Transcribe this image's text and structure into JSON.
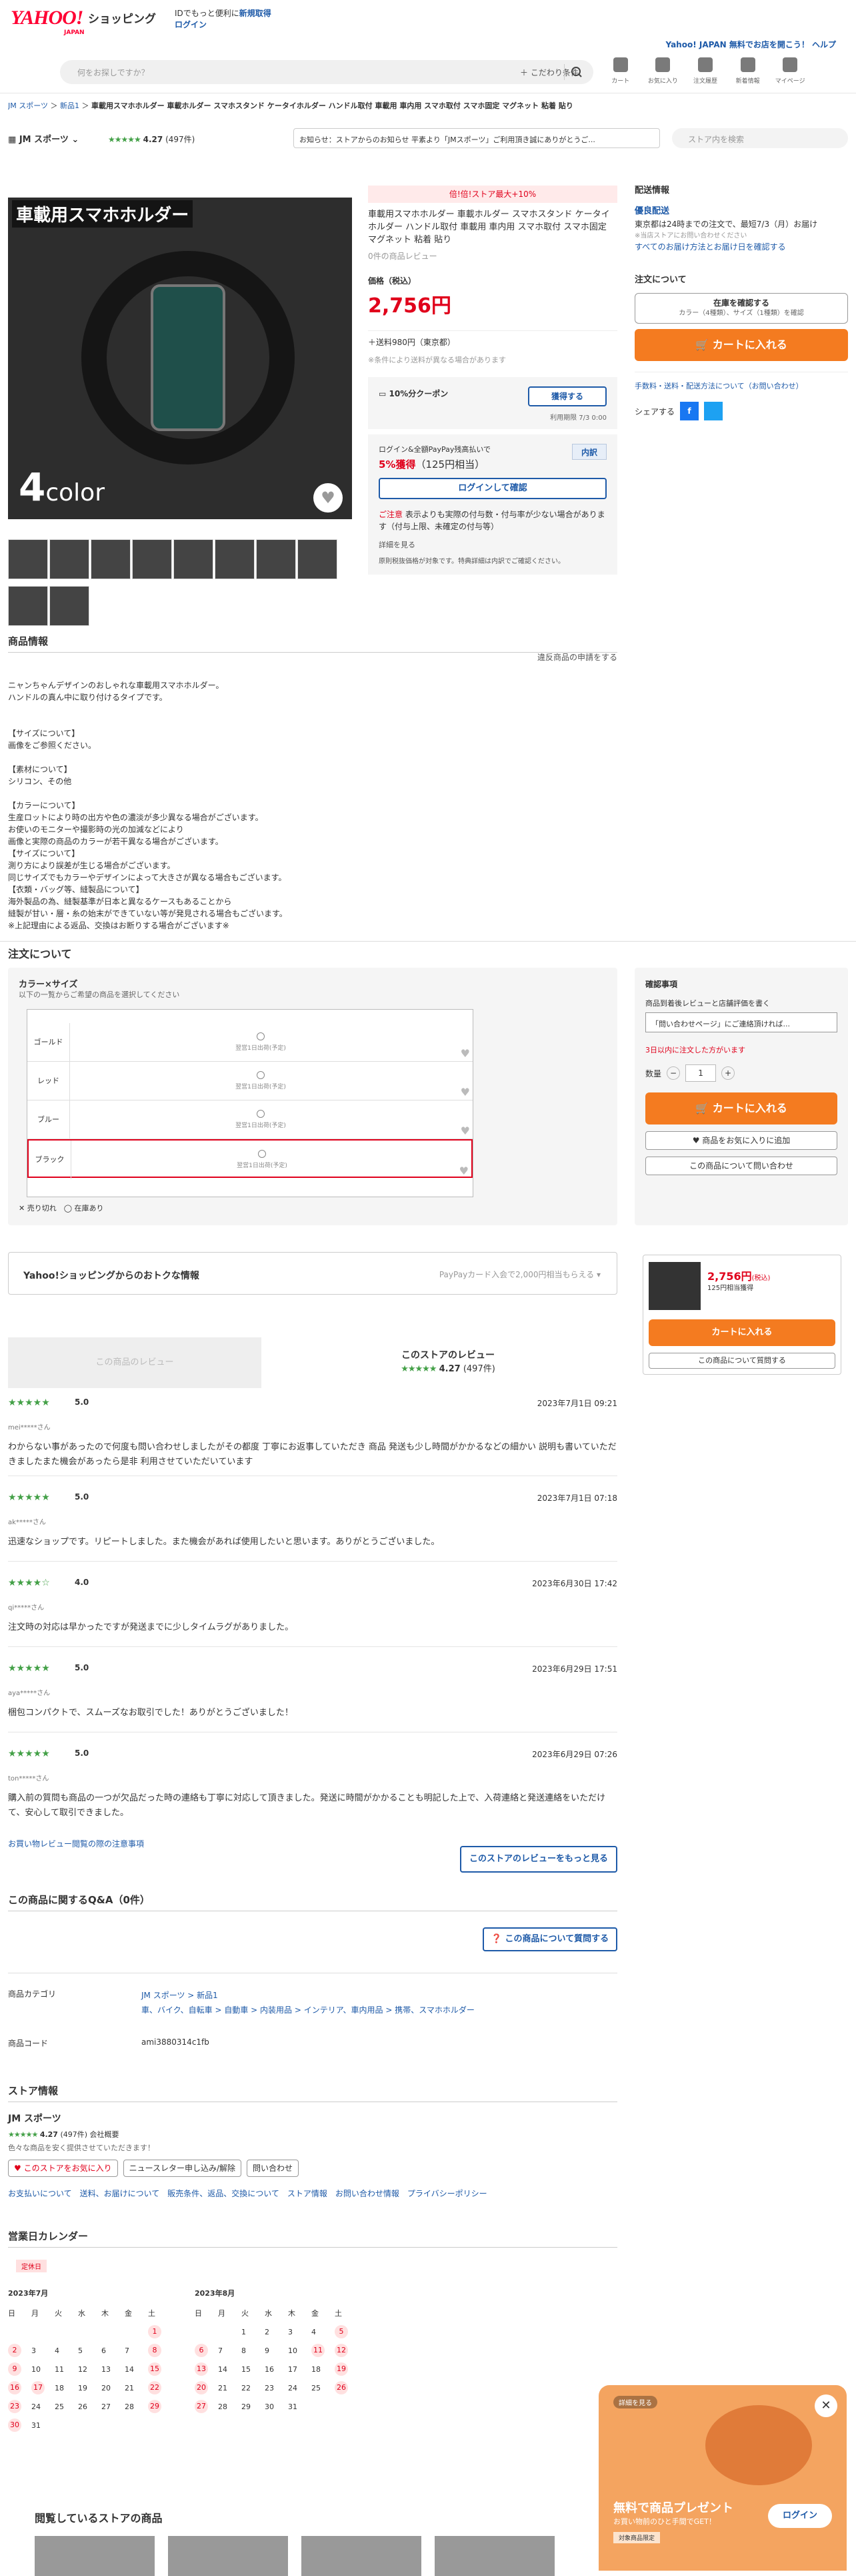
{
  "header": {
    "logo": "YAHOO!",
    "logo_sub": "JAPAN",
    "shopping": "ショッピング",
    "promo_line1": "IDでもっと便利に",
    "promo_link": "新規取得",
    "promo_login": "ログイン",
    "right_link": "Yahoo! JAPAN 無料でお店を開こう！ ヘルプ",
    "search_placeholder": "何をお探しですか？",
    "kodawari": "＋ こだわり条件",
    "nav": [
      "カート",
      "お気に入り",
      "注文履歴",
      "新着情報",
      "マイページ"
    ]
  },
  "breadcrumb": [
    "JM スポーツ",
    "新品1",
    "車載用スマホホルダー 車載ホルダー スマホスタンド ケータイホルダー ハンドル取付 車載用 車内用 スマホ取付 スマホ固定 マグネット 粘着 貼り"
  ],
  "store_bar": {
    "name": "JM スポーツ",
    "stars": "★★★★★",
    "rating": "4.27",
    "count": "(497件)",
    "notice": "お知らせ：ストアからのお知らせ 平素より「JMスポーツ」ご利用頂き誠にありがとうご...",
    "store_search_placeholder": "ストア内を検索"
  },
  "main_image": {
    "title": "車載用スマホホルダー",
    "color_count": "4",
    "color_word": "color"
  },
  "product": {
    "badge": "倍!倍!ストア最大+10%",
    "title": "車載用スマホホルダー 車載ホルダー スマホスタンド ケータイホルダー ハンドル取付 車載用 車内用 スマホ取付 スマホ固定 マグネット 粘着 貼り",
    "reviews": "0件の商品レビュー",
    "price_label": "価格（税込）",
    "price": "2,756円",
    "shipping": "＋送料980円（東京都）",
    "shipping_note": "※条件により送料が異なる場合があります",
    "coupon_name": "10%分クーポン",
    "coupon_btn": "獲得する",
    "coupon_limit": "利用期限 7/3 0:00",
    "pay_line": "ログイン&全額PayPay残高払いで",
    "points": "5%獲得",
    "points_sub": "（125円相当）",
    "points_detail": "内訳",
    "login_btn": "ログインして確認",
    "caution_label": "ご注意",
    "caution_text": "表示よりも実際の付与数・付与率が少ない場合があります（付与上限、未確定の付与等）",
    "detail_link": "詳細を見る",
    "note": "原則税抜価格が対象です。特典詳細は内訳でご確認ください。"
  },
  "side": {
    "delivery_h": "配送情報",
    "yusen": "優良配送",
    "deliv1": "東京都は24時までの注文で、最短7/3（月）お届け",
    "deliv_note": "※当店ストアにお問い合わせください",
    "deliv_link": "すべてのお届け方法とお届け日を確認する",
    "order_h": "注文について",
    "stock_btn": "在庫を確認する",
    "stock_sub": "カラー（4種類）、サイズ（1種類）を確認",
    "cart": "カートに入れる",
    "links": "手数料・送料・配送方法について（お問い合わせ）",
    "share": "シェアする"
  },
  "info": {
    "heading": "商品情報",
    "report": "違反商品の申請をする",
    "body": "ニャンちゃんデザインのおしゃれな車載用スマホホルダー。\nハンドルの真ん中に取り付けるタイプです。\n\n\n【サイズについて】\n画像をご参照ください。\n\n【素材について】\nシリコン、その他\n\n【カラーについて】\n生産ロットにより時の出方や色の濃淡が多少異なる場合がございます。\nお使いのモニターや撮影時の光の加減などにより\n画像と実際の商品のカラーが若干異なる場合がございます。\n【サイズについて】\n測り方により誤差が生じる場合がございます。\n同じサイズでもカラーやデザインによって大きさが異なる場合もございます。\n【衣類・バッグ等、縫製品について】\n海外製品の為、縫製基準が日本と異なるケースもあることから\n縫製が甘い・層・糸の始末ができていない等が発見される場合もございます。\n※上記理由による返品、交換はお断りする場合がございます※"
  },
  "order": {
    "heading": "注文について",
    "panel_title": "カラー×サイズ",
    "panel_sub": "以下の一覧からご希望の商品を選択してください",
    "rows": [
      {
        "name": "ゴールド",
        "status": "翌営1日出荷(予定)"
      },
      {
        "name": "レッド",
        "status": "翌営1日出荷(予定)"
      },
      {
        "name": "ブルー",
        "status": "翌営1日出荷(予定)"
      },
      {
        "name": "ブラック",
        "status": "翌営1日出荷(予定)"
      }
    ],
    "legend": "✕ 売り切れ　◯ 在庫あり",
    "conf_h": "確認事項",
    "conf_l": "商品到着後レビューと店舗評価を書く",
    "conf_sel": "「問い合わせページ」にご連絡頂ければ...",
    "conf_warn": "3日以内に注文した方がいます",
    "qty_label": "数量",
    "qty": "1",
    "cart": "カートに入れる",
    "fav": "♥ 商品をお気に入りに追加",
    "ask": "この商品について問い合わせ"
  },
  "deals": {
    "title": "Yahoo!ショッピングからのおトクな情報",
    "right": "PayPayカード入会で2,000円相当もらえる ▾"
  },
  "mini": {
    "price": "2,756円",
    "tax": "(税込)",
    "points": "125円相当獲得",
    "cart": "カートに入れる",
    "ask": "この商品について質問する"
  },
  "reviews": {
    "tab": "この商品のレビュー",
    "store_h": "このストアのレビュー",
    "stars": "★★★★★",
    "rating": "4.27",
    "count": "(497件)",
    "items": [
      {
        "stars": "★★★★★",
        "score": "5.0",
        "date": "2023年7月1日 09:21",
        "user": "mei*****さん",
        "text": "わからない事があったので何度も問い合わせしましたがその都度 丁寧にお返事していただき 商品 発送も少し時間がかかるなどの細かい 説明も書いていただきましたまた機会があったら是非 利用させていただいています"
      },
      {
        "stars": "★★★★★",
        "score": "5.0",
        "date": "2023年7月1日 07:18",
        "user": "ak*****さん",
        "text": "迅速なショップです。リピートしました。また機会があれば使用したいと思います。ありがとうございました。"
      },
      {
        "stars": "★★★★☆",
        "score": "4.0",
        "date": "2023年6月30日 17:42",
        "user": "qi*****さん",
        "text": "注文時の対応は早かったですが発送までに少しタイムラグがありました。"
      },
      {
        "stars": "★★★★★",
        "score": "5.0",
        "date": "2023年6月29日 17:51",
        "user": "aya*****さん",
        "text": "梱包コンパクトで、スムーズなお取引でした！ありがとうございました！"
      },
      {
        "stars": "★★★★★",
        "score": "5.0",
        "date": "2023年6月29日 07:26",
        "user": "ton*****さん",
        "text": "購入前の質問も商品の一つが欠品だった時の連絡も丁寧に対応して頂きました。発送に時間がかかることも明記した上で、入荷連絡と発送連絡をいただけて、安心して取引できました。"
      }
    ],
    "more_link": "お買い物レビュー閲覧の際の注意事項",
    "more_btn": "このストアのレビューをもっと見る"
  },
  "qa": {
    "heading": "この商品に関するQ&A（0件）",
    "btn": "この商品について質問する"
  },
  "category": {
    "label": "商品カテゴリ",
    "value1": "JM スポーツ > 新品1",
    "value2": "車、バイク、自転車 > 自動車 > 内装用品 > インテリア、車内用品 > 携帯、スマホホルダー",
    "code_label": "商品コード",
    "code": "ami3880314c1fb"
  },
  "store": {
    "heading": "ストア情報",
    "name": "JM スポーツ",
    "stars": "★★★★★",
    "rating": "4.27",
    "count": "(497件)",
    "type": "会社概要",
    "desc": "色々な商品を安く提供させていただきます！",
    "btn_fav": "♥ このストアをお気に入り",
    "btn_news": "ニュースレター申し込み/解除",
    "btn_ask": "問い合わせ",
    "links": "お支払いについて　送料、お届けについて　販売条件、返品、交換について　ストア情報　お問い合わせ情報　プライバシーポリシー"
  },
  "calendar": {
    "heading": "営業日カレンダー",
    "closed": "定休日",
    "m1": "2023年7月",
    "m2": "2023年8月",
    "days": [
      "日",
      "月",
      "火",
      "水",
      "木",
      "金",
      "土"
    ]
  },
  "popup": {
    "tag": "詳細を見る",
    "head": "無料で商品プレゼント",
    "sub": "お買い物前のひと手間でGET！",
    "login": "ログイン",
    "tag2": "対象商品限定"
  },
  "viewed": {
    "heading": "閲覧しているストアの商品"
  }
}
